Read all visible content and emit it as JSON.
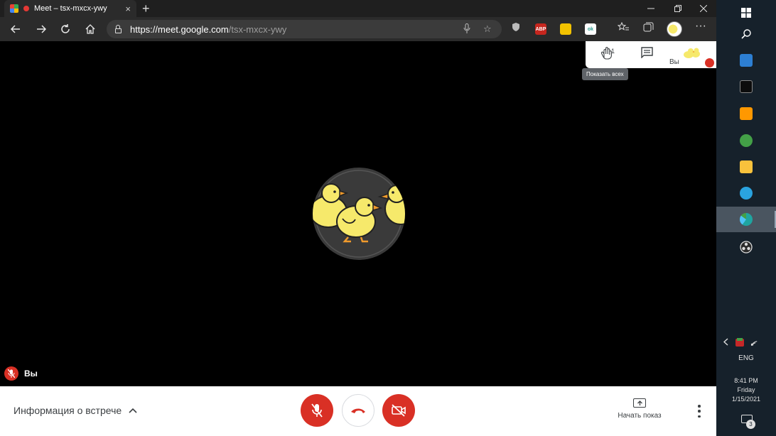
{
  "browser": {
    "tab_title": "Meet – tsx-mxcx-ywy",
    "tab_close": "×",
    "new_tab": "+",
    "url_host": "https://meet.google.com",
    "url_path": "/tsx-mxcx-ywy",
    "extensions": [
      {
        "name": "adblock",
        "label": "ABP",
        "color": "#c6261e"
      },
      {
        "name": "extension-yellow",
        "label": "",
        "color": "#f2c200"
      },
      {
        "name": "extension-ok",
        "label": "ok",
        "color": "#2a9d8f"
      }
    ]
  },
  "meet": {
    "participants_count": "1",
    "you_label": "Вы",
    "tooltip": "Показать всех",
    "self_name": "Вы",
    "meeting_info": "Информация о встрече",
    "share_label": "Начать показ",
    "colors": {
      "danger": "#d93025",
      "text": "#3c4043",
      "hangup": "#d93025"
    }
  },
  "taskbar": {
    "language": "ENG",
    "time": "8:41 PM",
    "day": "Friday",
    "date": "1/15/2021",
    "notifications": "3",
    "pinned_apps": [
      {
        "name": "calculator",
        "color": "#2d7fd3"
      },
      {
        "name": "terminal",
        "color": "#0c0c0c"
      },
      {
        "name": "sublime-text",
        "color": "#ff9800"
      },
      {
        "name": "globe-app",
        "color": "#43a047"
      },
      {
        "name": "file-explorer",
        "color": "#f9c23c"
      },
      {
        "name": "telegram",
        "color": "#2aa3df"
      },
      {
        "name": "edge",
        "color": "#1fa5a0"
      },
      {
        "name": "obs-studio",
        "color": "#2a2a2a"
      }
    ]
  }
}
